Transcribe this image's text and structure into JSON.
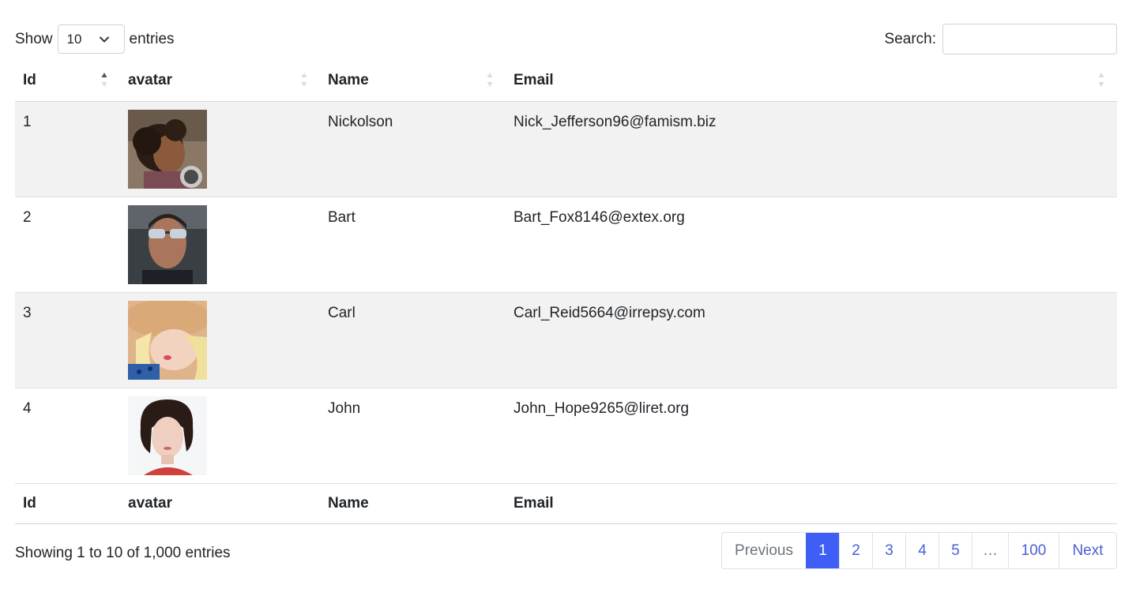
{
  "length_control": {
    "prefix": "Show",
    "selected": "10",
    "suffix": "entries"
  },
  "search": {
    "label": "Search:",
    "value": "",
    "placeholder": ""
  },
  "table": {
    "columns": [
      "Id",
      "avatar",
      "Name",
      "Email"
    ],
    "rows": [
      {
        "id": "1",
        "name": "Nickolson",
        "email": "Nick_Jefferson96@famism.biz"
      },
      {
        "id": "2",
        "name": "Bart",
        "email": "Bart_Fox8146@extex.org"
      },
      {
        "id": "3",
        "name": "Carl",
        "email": "Carl_Reid5664@irrepsy.com"
      },
      {
        "id": "4",
        "name": "John",
        "email": "John_Hope9265@liret.org"
      }
    ],
    "footer_columns": [
      "Id",
      "avatar",
      "Name",
      "Email"
    ]
  },
  "info": "Showing 1 to 10 of 1,000 entries",
  "pagination": {
    "previous": "Previous",
    "pages": [
      "1",
      "2",
      "3",
      "4",
      "5"
    ],
    "ellipsis": "…",
    "last": "100",
    "next": "Next",
    "active": "1"
  },
  "colors": {
    "accent": "#3f5ef6",
    "link": "#4a5fd6",
    "stripe": "#f2f2f2"
  }
}
